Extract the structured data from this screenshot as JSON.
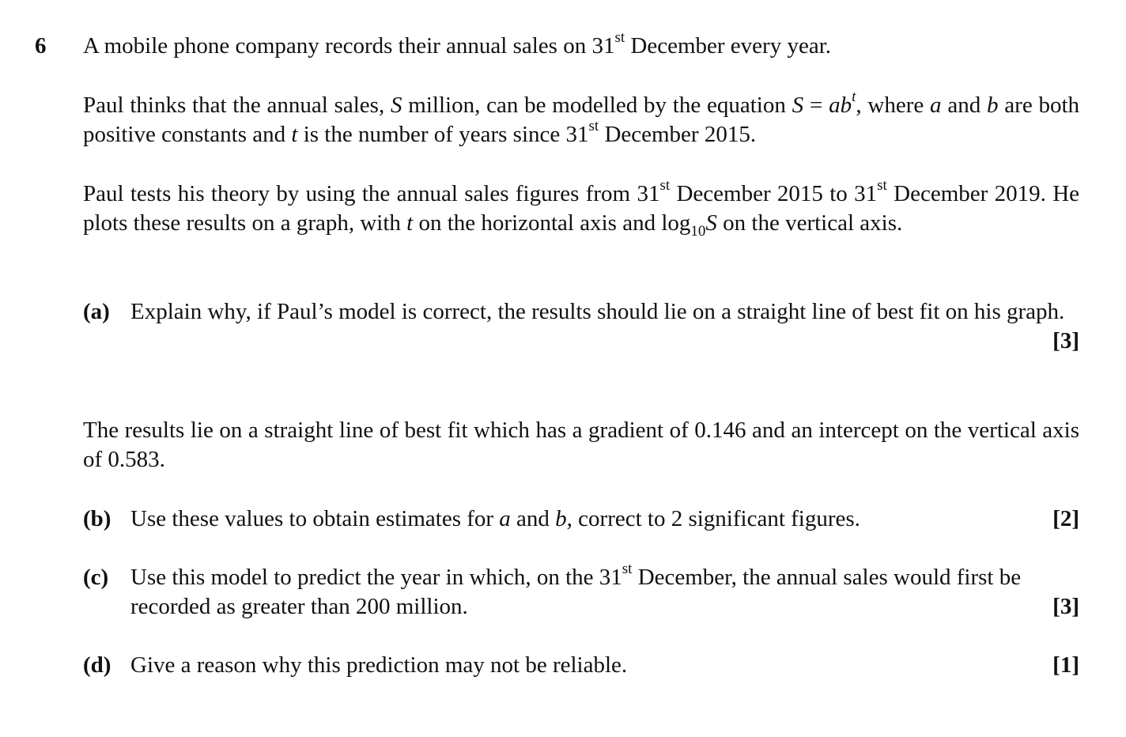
{
  "question_number": "6",
  "intro": {
    "p1": {
      "a": "A mobile phone company records their annual sales on 31",
      "sup": "st",
      "b": " December every year."
    },
    "p2": {
      "a": "Paul thinks that the annual sales, ",
      "var_S": "S",
      "b": " million, can be modelled by the equation ",
      "eq_S": "S",
      "eq_eq": " = ",
      "eq_ab": "ab",
      "eq_t": "t",
      "c": ", where ",
      "var_a": "a",
      "d": " and",
      "var_b": "b",
      "e": " are both positive constants and ",
      "var_t": "t",
      "f": " is the number of years since 31",
      "sup": "st",
      "g": " December 2015."
    },
    "p3": {
      "a": "Paul tests his theory by using the annual sales figures from 31",
      "sup1": "st",
      "b": " December 2015 to 31",
      "sup2": "st",
      "c": " December 2019. He plots these results on a graph, with ",
      "var_t": "t",
      "d": " on the horizontal axis and log",
      "sub": "10",
      "var_S": "S",
      "e": " on the vertical axis."
    }
  },
  "part_a": {
    "label": "(a)",
    "text": "Explain why, if Paul’s model is correct, the results should lie on a straight line of best fit on his graph.",
    "marks": "[3]"
  },
  "results_para": "The results lie on a straight line of best fit which has a gradient of 0.146 and an intercept on the vertical axis of 0.583.",
  "part_b": {
    "label": "(b)",
    "a": "Use these values to obtain estimates for ",
    "var_a": "a",
    "b": " and ",
    "var_b": "b",
    "c": ", correct to 2 significant figures.",
    "marks": "[2]"
  },
  "part_c": {
    "label": "(c)",
    "a": "Use this model to predict the year in which, on the 31",
    "sup": "st",
    "b": " December, the annual sales would first be recorded as greater than 200 million.",
    "marks": "[3]"
  },
  "part_d": {
    "label": "(d)",
    "text": "Give a reason why this prediction may not be reliable.",
    "marks": "[1]"
  }
}
